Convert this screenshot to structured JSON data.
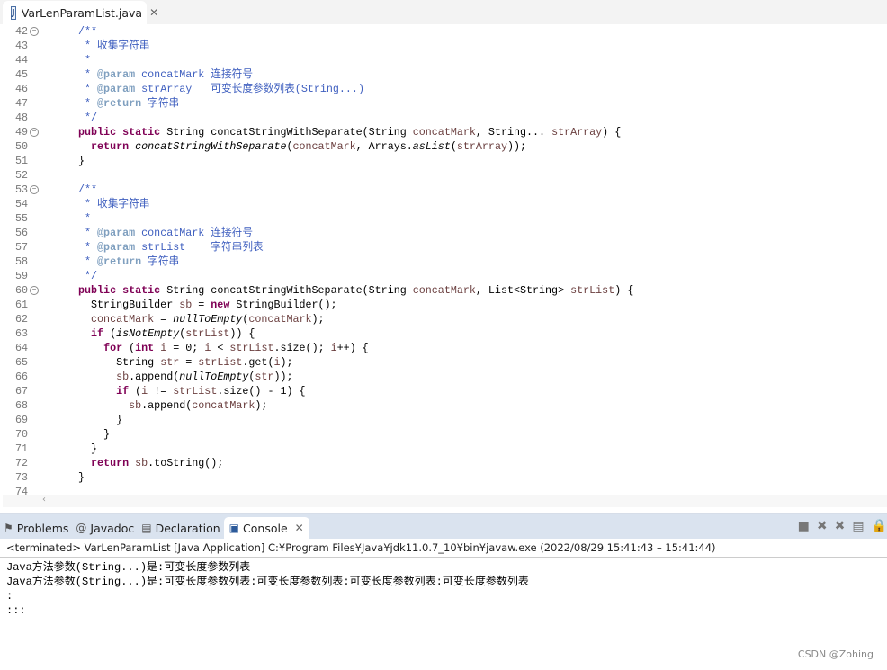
{
  "editor_tab": {
    "title": "VarLenParamList.java",
    "icon": "java-file-icon"
  },
  "first_line": 42,
  "fold_lines": [
    42,
    49,
    53,
    60
  ],
  "code": [
    [
      [
        "doc",
        "/**"
      ]
    ],
    [
      [
        "doc",
        " * 收集字符串"
      ]
    ],
    [
      [
        "doc",
        " *"
      ]
    ],
    [
      [
        "doc",
        " * "
      ],
      [
        "tag",
        "@param"
      ],
      [
        "doc",
        " concatMark 连接符号"
      ]
    ],
    [
      [
        "doc",
        " * "
      ],
      [
        "tag",
        "@param"
      ],
      [
        "doc",
        " strArray   可变长度参数列表(String...)"
      ]
    ],
    [
      [
        "doc",
        " * "
      ],
      [
        "tag",
        "@return"
      ],
      [
        "doc",
        " 字符串"
      ]
    ],
    [
      [
        "doc",
        " */"
      ]
    ],
    [
      [
        "kw",
        "public"
      ],
      [
        "p",
        " "
      ],
      [
        "kw",
        "static"
      ],
      [
        "p",
        " String concatStringWithSeparate(String "
      ],
      [
        "var",
        "concatMark"
      ],
      [
        "p",
        ", String... "
      ],
      [
        "var",
        "strArray"
      ],
      [
        "p",
        ") {"
      ]
    ],
    [
      [
        "p",
        "  "
      ],
      [
        "kw",
        "return"
      ],
      [
        "p",
        " "
      ],
      [
        "it",
        "concatStringWithSeparate"
      ],
      [
        "p",
        "("
      ],
      [
        "var",
        "concatMark"
      ],
      [
        "p",
        ", Arrays."
      ],
      [
        "it",
        "asList"
      ],
      [
        "p",
        "("
      ],
      [
        "var",
        "strArray"
      ],
      [
        "p",
        "));"
      ]
    ],
    [
      [
        "p",
        "}"
      ]
    ],
    [
      [
        "p",
        ""
      ]
    ],
    [
      [
        "doc",
        "/**"
      ]
    ],
    [
      [
        "doc",
        " * 收集字符串"
      ]
    ],
    [
      [
        "doc",
        " *"
      ]
    ],
    [
      [
        "doc",
        " * "
      ],
      [
        "tag",
        "@param"
      ],
      [
        "doc",
        " concatMark 连接符号"
      ]
    ],
    [
      [
        "doc",
        " * "
      ],
      [
        "tag",
        "@param"
      ],
      [
        "doc",
        " strList    字符串列表"
      ]
    ],
    [
      [
        "doc",
        " * "
      ],
      [
        "tag",
        "@return"
      ],
      [
        "doc",
        " 字符串"
      ]
    ],
    [
      [
        "doc",
        " */"
      ]
    ],
    [
      [
        "kw",
        "public"
      ],
      [
        "p",
        " "
      ],
      [
        "kw",
        "static"
      ],
      [
        "p",
        " String concatStringWithSeparate(String "
      ],
      [
        "var",
        "concatMark"
      ],
      [
        "p",
        ", List<String> "
      ],
      [
        "var",
        "strList"
      ],
      [
        "p",
        ") {"
      ]
    ],
    [
      [
        "p",
        "  StringBuilder "
      ],
      [
        "var",
        "sb"
      ],
      [
        "p",
        " = "
      ],
      [
        "kw",
        "new"
      ],
      [
        "p",
        " StringBuilder();"
      ]
    ],
    [
      [
        "p",
        "  "
      ],
      [
        "var",
        "concatMark"
      ],
      [
        "p",
        " = "
      ],
      [
        "it",
        "nullToEmpty"
      ],
      [
        "p",
        "("
      ],
      [
        "var",
        "concatMark"
      ],
      [
        "p",
        ");"
      ]
    ],
    [
      [
        "p",
        "  "
      ],
      [
        "kw",
        "if"
      ],
      [
        "p",
        " ("
      ],
      [
        "it",
        "isNotEmpty"
      ],
      [
        "p",
        "("
      ],
      [
        "var",
        "strList"
      ],
      [
        "p",
        ")) {"
      ]
    ],
    [
      [
        "p",
        "    "
      ],
      [
        "kw",
        "for"
      ],
      [
        "p",
        " ("
      ],
      [
        "kw",
        "int"
      ],
      [
        "p",
        " "
      ],
      [
        "var",
        "i"
      ],
      [
        "p",
        " = 0; "
      ],
      [
        "var",
        "i"
      ],
      [
        "p",
        " < "
      ],
      [
        "var",
        "strList"
      ],
      [
        "p",
        ".size(); "
      ],
      [
        "var",
        "i"
      ],
      [
        "p",
        "++) {"
      ]
    ],
    [
      [
        "p",
        "      String "
      ],
      [
        "var",
        "str"
      ],
      [
        "p",
        " = "
      ],
      [
        "var",
        "strList"
      ],
      [
        "p",
        ".get("
      ],
      [
        "var",
        "i"
      ],
      [
        "p",
        ");"
      ]
    ],
    [
      [
        "p",
        "      "
      ],
      [
        "var",
        "sb"
      ],
      [
        "p",
        ".append("
      ],
      [
        "it",
        "nullToEmpty"
      ],
      [
        "p",
        "("
      ],
      [
        "var",
        "str"
      ],
      [
        "p",
        "));"
      ]
    ],
    [
      [
        "p",
        "      "
      ],
      [
        "kw",
        "if"
      ],
      [
        "p",
        " ("
      ],
      [
        "var",
        "i"
      ],
      [
        "p",
        " != "
      ],
      [
        "var",
        "strList"
      ],
      [
        "p",
        ".size() - 1) {"
      ]
    ],
    [
      [
        "p",
        "        "
      ],
      [
        "var",
        "sb"
      ],
      [
        "p",
        ".append("
      ],
      [
        "var",
        "concatMark"
      ],
      [
        "p",
        ");"
      ]
    ],
    [
      [
        "p",
        "      }"
      ]
    ],
    [
      [
        "p",
        "    }"
      ]
    ],
    [
      [
        "p",
        "  }"
      ]
    ],
    [
      [
        "p",
        "  "
      ],
      [
        "kw",
        "return"
      ],
      [
        "p",
        " "
      ],
      [
        "var",
        "sb"
      ],
      [
        "p",
        ".toString();"
      ]
    ],
    [
      [
        "p",
        "}"
      ]
    ],
    [
      [
        "p",
        ""
      ]
    ]
  ],
  "panel": {
    "tabs": [
      {
        "label": "Problems",
        "icon": "problems-icon"
      },
      {
        "label": "Javadoc",
        "icon": "at-icon"
      },
      {
        "label": "Declaration",
        "icon": "declaration-icon"
      },
      {
        "label": "Console",
        "icon": "console-icon",
        "active": true
      }
    ],
    "status": "<terminated> VarLenParamList [Java Application] C:¥Program Files¥Java¥jdk11.0.7_10¥bin¥javaw.exe  (2022/08/29 15:41:43 – 15:41:44)",
    "output": [
      "Java方法参数(String...)是:可变长度参数列表",
      "Java方法参数(String...)是:可变长度参数列表:可变长度参数列表:可变长度参数列表:可变长度参数列表",
      ":",
      ":::"
    ]
  },
  "watermark": "CSDN @Zohing"
}
